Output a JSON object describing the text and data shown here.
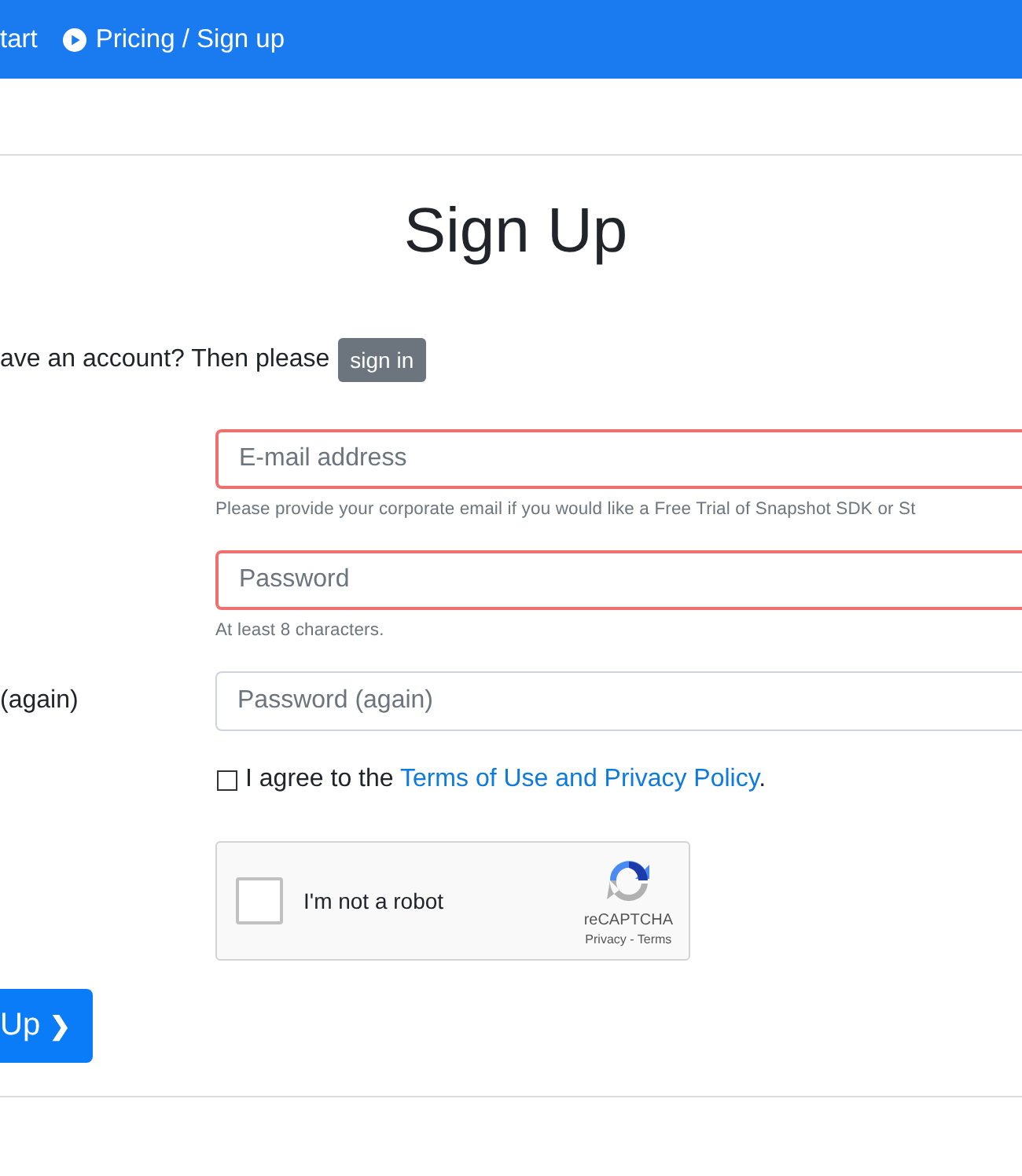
{
  "navbar": {
    "items": [
      {
        "label": "tart",
        "icon": false
      },
      {
        "label": "Pricing / Sign up",
        "icon": true
      }
    ]
  },
  "heading": "Sign Up",
  "signin_prompt": {
    "text": "ave an account? Then please",
    "button": "sign in"
  },
  "fields": [
    {
      "placeholder": "E-mail address",
      "invalid": true,
      "hint": "Please provide your corporate email if you would like a Free Trial of Snapshot SDK or St"
    },
    {
      "placeholder": "Password",
      "invalid": true,
      "hint": "At least 8 characters."
    },
    {
      "label": "(again)",
      "placeholder": "Password (again)",
      "invalid": false
    }
  ],
  "agree": {
    "checked": false,
    "text": "I agree to the ",
    "link": "Terms of Use and Privacy Policy",
    "after": "."
  },
  "captcha": {
    "checked": false,
    "label": "I'm not a robot",
    "brand": "reCAPTCHA",
    "links": "Privacy - Terms"
  },
  "submit": {
    "label": "Up",
    "icon": "❯"
  }
}
